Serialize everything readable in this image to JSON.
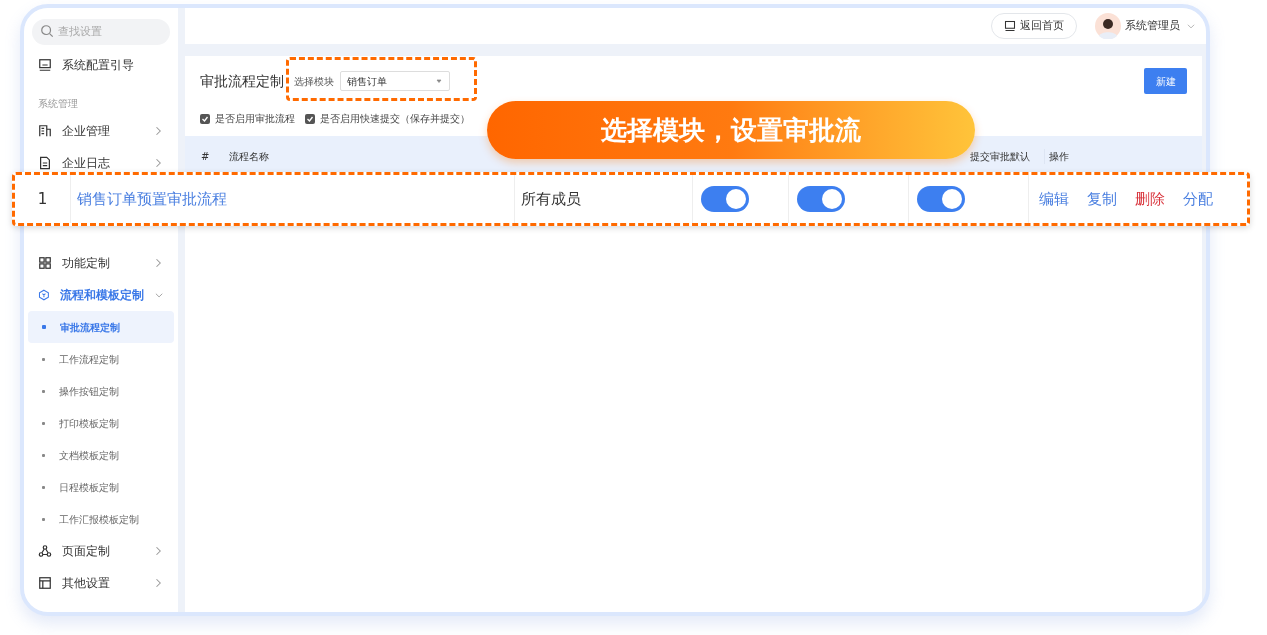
{
  "search": {
    "placeholder": "查找设置"
  },
  "sidebar": {
    "guide": "系统配置引导",
    "section": "系统管理",
    "items": [
      {
        "label": "企业管理",
        "expanded": false
      },
      {
        "label": "企业日志",
        "expanded": false
      },
      {
        "label": "功能定制",
        "expanded": false
      },
      {
        "label": "流程和模板定制",
        "expanded": true,
        "children": [
          {
            "label": "审批流程定制",
            "selected": true
          },
          {
            "label": "工作流程定制",
            "selected": false
          },
          {
            "label": "操作按钮定制",
            "selected": false
          },
          {
            "label": "打印模板定制",
            "selected": false
          },
          {
            "label": "文档模板定制",
            "selected": false
          },
          {
            "label": "日程模板定制",
            "selected": false
          },
          {
            "label": "工作汇报模板定制",
            "selected": false
          }
        ]
      },
      {
        "label": "页面定制",
        "expanded": false
      },
      {
        "label": "其他设置",
        "expanded": false
      }
    ]
  },
  "header": {
    "home_button": "返回首页",
    "user": "系统管理员"
  },
  "panel": {
    "title": "审批流程定制",
    "module_label": "选择模块",
    "module_value": "销售订单",
    "new_button": "新建",
    "options": [
      {
        "label": "是否启用审批流程",
        "checked": true
      },
      {
        "label": "是否启用快速提交（保存并提交）",
        "checked": true
      }
    ],
    "columns": [
      "#",
      "流程名称",
      "提交审批默认",
      "操作"
    ]
  },
  "row": {
    "index": "1",
    "name": "销售订单预置审批流程",
    "scope": "所有成员",
    "toggles": [
      {
        "on": true
      },
      {
        "on": true
      },
      {
        "on": true
      }
    ],
    "actions": [
      {
        "label": "编辑",
        "kind": "normal"
      },
      {
        "label": "复制",
        "kind": "normal"
      },
      {
        "label": "删除",
        "kind": "danger"
      },
      {
        "label": "分配",
        "kind": "normal"
      }
    ]
  },
  "callout": "选择模块，设置审批流"
}
